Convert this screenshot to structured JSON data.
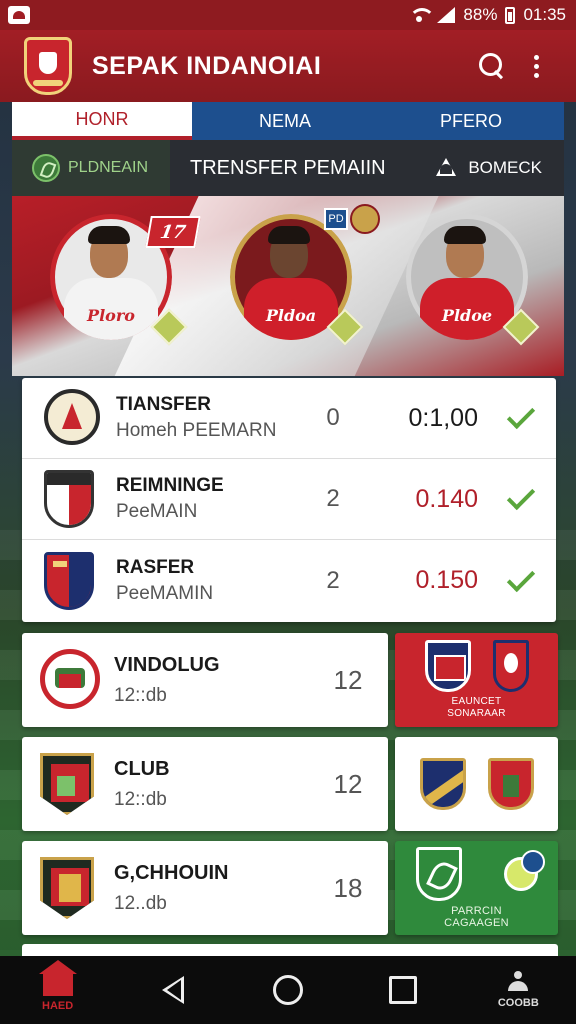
{
  "status_bar": {
    "battery": "88%",
    "time": "01:35"
  },
  "app_bar": {
    "title": "SEPAK INDANOIAI"
  },
  "top_tabs": [
    {
      "label": "HONR",
      "active": true
    },
    {
      "label": "NEMA",
      "active": false
    },
    {
      "label": "PFERO",
      "active": false
    }
  ],
  "sub_tabs": {
    "first": "PLDNEAIN",
    "middle": "TRENSFER PEMAIIN",
    "last": "BOMECK"
  },
  "hero": {
    "badge_left": "17",
    "badge_square": "PD",
    "players": [
      {
        "shirt_text": "Ploro"
      },
      {
        "shirt_text": "Pldoa"
      },
      {
        "shirt_text": "Pldoe"
      }
    ]
  },
  "transfers": [
    {
      "title": "TIANSFER",
      "subtitle": "Homeh PEEMARN",
      "count": "0",
      "value": "0:1,00",
      "value_color": "#1a1a1a"
    },
    {
      "title": "REIMNINGE",
      "subtitle": "PeeMAIN",
      "count": "2",
      "value": "0.140",
      "value_color": "#b0202a"
    },
    {
      "title": "RASFER",
      "subtitle": "PeeMAMIN",
      "count": "2",
      "value": "0.150",
      "value_color": "#b0202a"
    }
  ],
  "clubs": [
    {
      "name": "VINDOLUG",
      "sub": "12::db",
      "num": "12"
    },
    {
      "name": "CLUB",
      "sub": "12::db",
      "num": "12"
    },
    {
      "name": "G,CHHOUIN",
      "sub": "12..db",
      "num": "18"
    }
  ],
  "tiles": {
    "first_caption_line1": "EAUNCET",
    "first_caption_line2": "SONARAAR",
    "third_caption_line1": "PARRCIN",
    "third_caption_line2": "CAGAAGEN"
  },
  "bottom_nav": {
    "home_label": "HAED",
    "coach_label": "COOBB"
  },
  "colors": {
    "primary_red": "#a21e25",
    "accent_blue": "#1d4f8e",
    "check_green": "#5aa63c"
  }
}
